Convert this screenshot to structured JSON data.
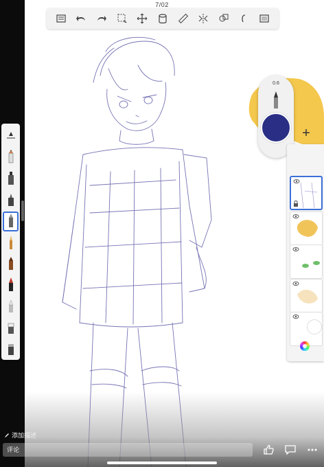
{
  "status_bar": {
    "center_text": "7/02"
  },
  "top_toolbar": {
    "items": [
      {
        "name": "gallery-icon"
      },
      {
        "name": "undo-icon"
      },
      {
        "name": "redo-icon"
      },
      {
        "name": "selection-icon"
      },
      {
        "name": "transform-icon"
      },
      {
        "name": "layer-fill-icon"
      },
      {
        "name": "ruler-icon"
      },
      {
        "name": "symmetry-icon"
      },
      {
        "name": "shapes-icon"
      },
      {
        "name": "text-icon"
      },
      {
        "name": "canvas-view-icon"
      }
    ]
  },
  "left_tools": {
    "items": [
      {
        "name": "tool-settings-icon"
      },
      {
        "name": "pencil-tool"
      },
      {
        "name": "marker-tool"
      },
      {
        "name": "airbrush-tool"
      },
      {
        "name": "fine-pen-tool",
        "active": true
      },
      {
        "name": "paint-brush-tool"
      },
      {
        "name": "crayon-tool"
      },
      {
        "name": "ink-pen-tool"
      },
      {
        "name": "soft-brush-tool"
      },
      {
        "name": "eraser-tool"
      },
      {
        "name": "smudge-tool"
      }
    ]
  },
  "brush_puck": {
    "size_value": "0.6",
    "current_color": "#2a2f85"
  },
  "layers": {
    "add_label": "+",
    "items": [
      {
        "name": "layer-1",
        "active": true,
        "locked": true
      },
      {
        "name": "layer-2"
      },
      {
        "name": "layer-3"
      },
      {
        "name": "layer-4"
      },
      {
        "name": "layer-5"
      }
    ]
  },
  "bottom_bar": {
    "add_description": "添加描述",
    "comment_placeholder": "评论"
  },
  "colors": {
    "accent": "#3a6fd8",
    "ink": "#5a58a8"
  }
}
